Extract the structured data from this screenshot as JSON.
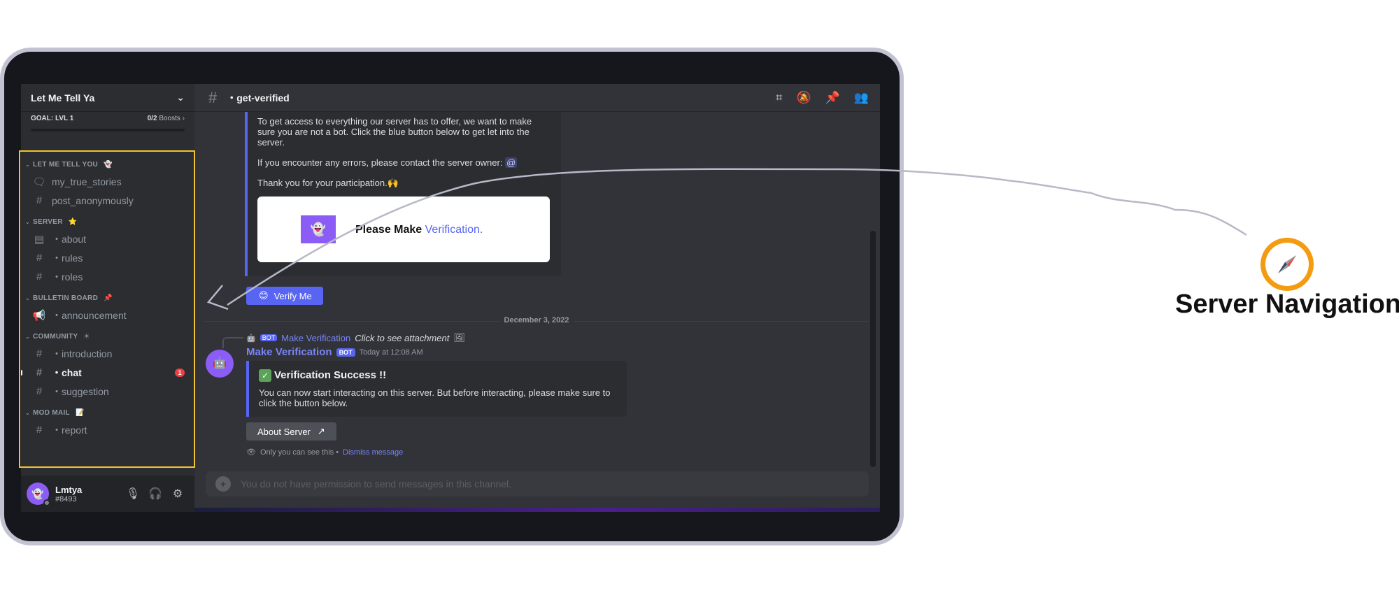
{
  "server": {
    "name": "Let Me Tell Ya",
    "boost_goal": "GOAL: LVL 1",
    "boost_count": "0/2",
    "boost_label": "Boosts"
  },
  "categories": [
    {
      "name": "LET ME TELL YOU",
      "emoji": "👻",
      "channels": [
        {
          "icon": "forum-icon",
          "glyph": "🗨",
          "name": "my_true_stories"
        },
        {
          "icon": "hash-icon",
          "glyph": "#",
          "name": "post_anonymously"
        }
      ]
    },
    {
      "name": "SERVER",
      "emoji": "⭐",
      "channels": [
        {
          "icon": "rules-icon",
          "glyph": "▤",
          "name": "・about"
        },
        {
          "icon": "hash-icon",
          "glyph": "#",
          "name": "・rules"
        },
        {
          "icon": "hash-icon",
          "glyph": "#",
          "name": "・roles"
        }
      ]
    },
    {
      "name": "BULLETIN BOARD",
      "emoji": "📌",
      "channels": [
        {
          "icon": "announcement-icon",
          "glyph": "📢",
          "name": "・announcement"
        }
      ]
    },
    {
      "name": "COMMUNITY",
      "emoji": "☀",
      "channels": [
        {
          "icon": "hash-icon",
          "glyph": "#",
          "name": "・introduction"
        },
        {
          "icon": "hash-icon",
          "glyph": "#",
          "name": "・chat",
          "active": true,
          "badge": "1"
        },
        {
          "icon": "hash-icon",
          "glyph": "#",
          "name": "・suggestion"
        }
      ]
    },
    {
      "name": "MOD MAIL",
      "emoji": "📝",
      "channels": [
        {
          "icon": "hash-icon",
          "glyph": "#",
          "name": "・report"
        }
      ]
    }
  ],
  "user": {
    "name": "Lmtya",
    "tag": "#8493"
  },
  "channel_header": {
    "name": "・get-verified"
  },
  "welcome_embed": {
    "p1": "To get access to everything our server has to offer, we want to make sure you are not a bot. Click the blue button below to get let into the server.",
    "p2": "If you encounter any errors, please contact the server owner:",
    "mention": "@",
    "p3": "Thank you for your participation.🙌",
    "card_text": "Please Make",
    "card_highlight": "Verification."
  },
  "verify_button": "Verify Me",
  "date_divider": "December 3, 2022",
  "reply": {
    "bot_tag": "BOT",
    "author": "Make Verification",
    "text": "Click to see attachment"
  },
  "message": {
    "author": "Make Verification",
    "bot_tag": "BOT",
    "timestamp": "Today at 12:08 AM",
    "embed_title": "Verification Success !!",
    "embed_body": "You can now start interacting on this server. But before interacting, please make sure to click the button below."
  },
  "about_button": "About Server",
  "ephemeral": {
    "text": "Only you can see this •",
    "dismiss": "Dismiss message"
  },
  "composer_placeholder": "You do not have permission to send messages in this channel.",
  "annotation": {
    "label": "Server Navigation",
    "color": "#f0c330"
  }
}
